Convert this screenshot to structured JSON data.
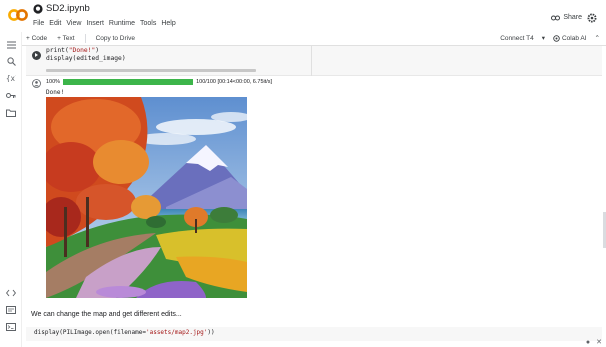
{
  "header": {
    "doc_title": "SD2.ipynb",
    "menu": [
      "File",
      "Edit",
      "View",
      "Insert",
      "Runtime",
      "Tools",
      "Help"
    ],
    "share_label": "Share"
  },
  "toolbar": {
    "add_code": "+ Code",
    "add_text": "+ Text",
    "copy_to_drive": "Copy to Drive",
    "connect": "Connect T4",
    "colab_ai": "Colab AI"
  },
  "code_cell": {
    "line1_fn": "print(",
    "line1_str": "\"Done!\"",
    "line1_end": ")",
    "line2": "display(edited_image)"
  },
  "output": {
    "progress_percent": 100,
    "percent_label": "100%",
    "progress_stats": "100/100 [00:14<00:00,  6.75it/s]",
    "done": "Done!"
  },
  "markdown": {
    "text": "We can change the map and get different edits..."
  },
  "next_cell": {
    "code_a": "display(PILImage.open(filename=",
    "code_str": "'assets/map2.jpg'",
    "code_b": "))"
  },
  "colors": {
    "accent_progress": "#3cb54a",
    "colab_orange": "#f9ab00",
    "colab_orange_dark": "#e37400"
  }
}
